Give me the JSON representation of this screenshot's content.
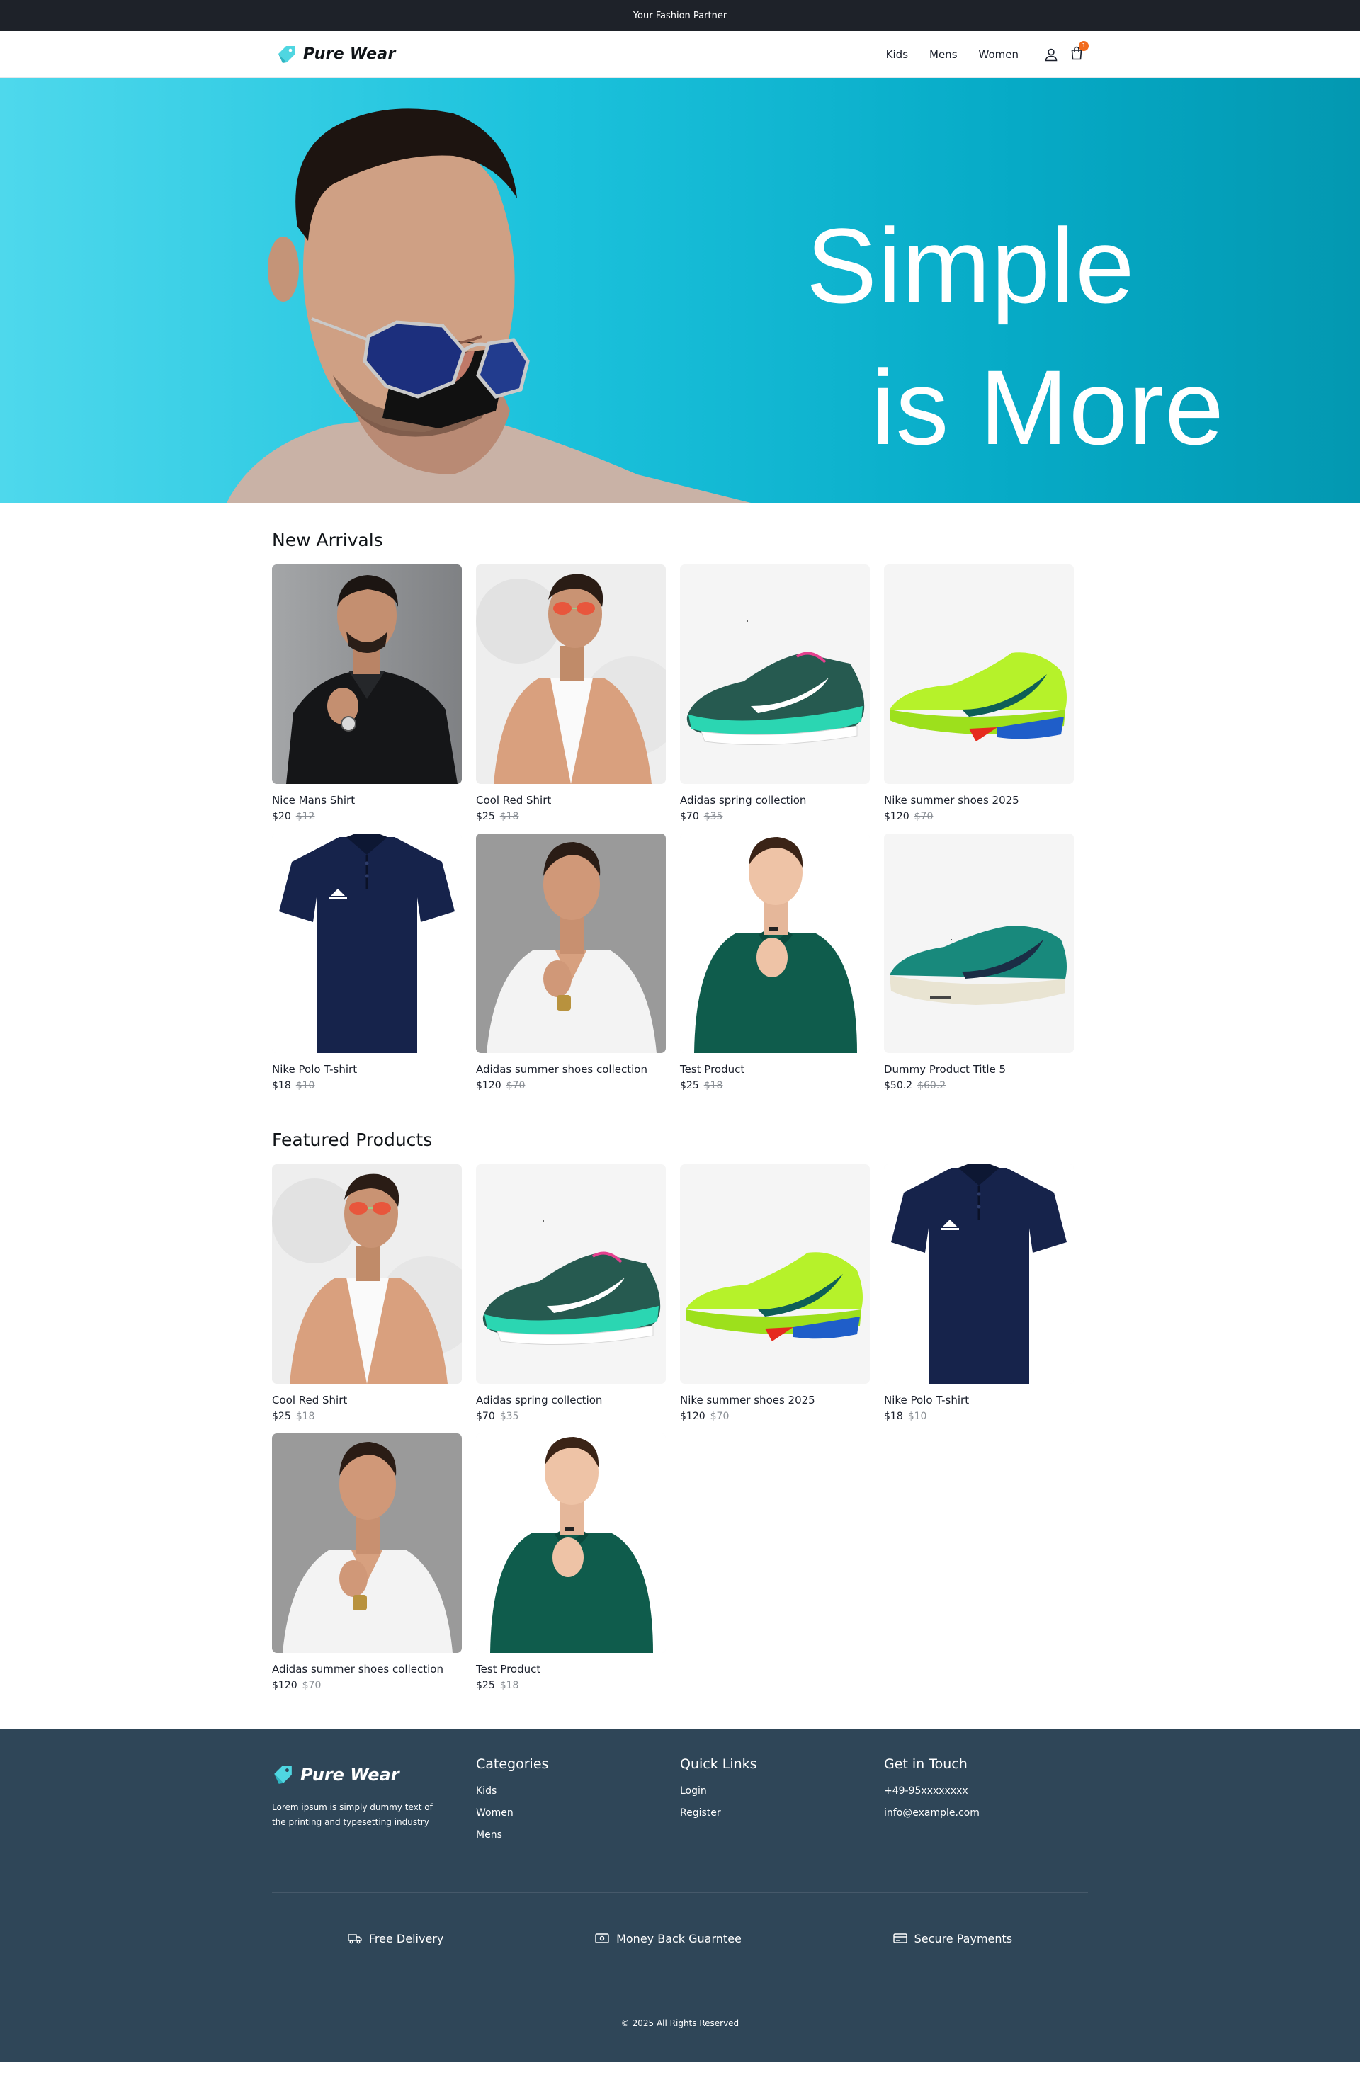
{
  "topbar": {
    "text": "Your Fashion Partner"
  },
  "brand": {
    "name": "Pure Wear",
    "accent": "#4fd6e1"
  },
  "nav": {
    "links": [
      "Kids",
      "Mens",
      "Women"
    ],
    "cart_count": "1",
    "icons": [
      "user-icon",
      "cart-icon"
    ]
  },
  "hero": {
    "line1": "Simple",
    "line2": "is More"
  },
  "new_arrivals": {
    "title": "New Arrivals",
    "products": [
      {
        "name": "Nice Mans Shirt",
        "price": "$20",
        "old_price": "$12"
      },
      {
        "name": "Cool Red Shirt",
        "price": "$25",
        "old_price": "$18"
      },
      {
        "name": "Adidas spring collection",
        "price": "$70",
        "old_price": "$35"
      },
      {
        "name": "Nike summer shoes 2025",
        "price": "$120",
        "old_price": "$70"
      },
      {
        "name": "Nike Polo T-shirt",
        "price": "$18",
        "old_price": "$10"
      },
      {
        "name": "Adidas summer shoes collection",
        "price": "$120",
        "old_price": "$70"
      },
      {
        "name": "Test Product",
        "price": "$25",
        "old_price": "$18"
      },
      {
        "name": "Dummy Product Title 5",
        "price": "$50.2",
        "old_price": "$60.2"
      }
    ]
  },
  "featured": {
    "title": "Featured Products",
    "products": [
      {
        "name": "Cool Red Shirt",
        "price": "$25",
        "old_price": "$18"
      },
      {
        "name": "Adidas spring collection",
        "price": "$70",
        "old_price": "$35"
      },
      {
        "name": "Nike summer shoes 2025",
        "price": "$120",
        "old_price": "$70"
      },
      {
        "name": "Nike Polo T-shirt",
        "price": "$18",
        "old_price": "$10"
      },
      {
        "name": "Adidas summer shoes collection",
        "price": "$120",
        "old_price": "$70"
      },
      {
        "name": "Test Product",
        "price": "$25",
        "old_price": "$18"
      }
    ]
  },
  "footer": {
    "about": "Lorem ipsum is simply dummy text of the printing and typesetting industry",
    "categories": {
      "title": "Categories",
      "links": [
        "Kids",
        "Women",
        "Mens"
      ]
    },
    "quick_links": {
      "title": "Quick Links",
      "links": [
        "Login",
        "Register"
      ]
    },
    "contact": {
      "title": "Get in Touch",
      "phone": "+49-95xxxxxxxx",
      "email": "info@example.com"
    },
    "features": [
      "Free Delivery",
      "Money Back Guarntee",
      "Secure Payments"
    ],
    "copyright": "© 2025 All Rights Reserved",
    "bg_color": "#2f4658"
  }
}
